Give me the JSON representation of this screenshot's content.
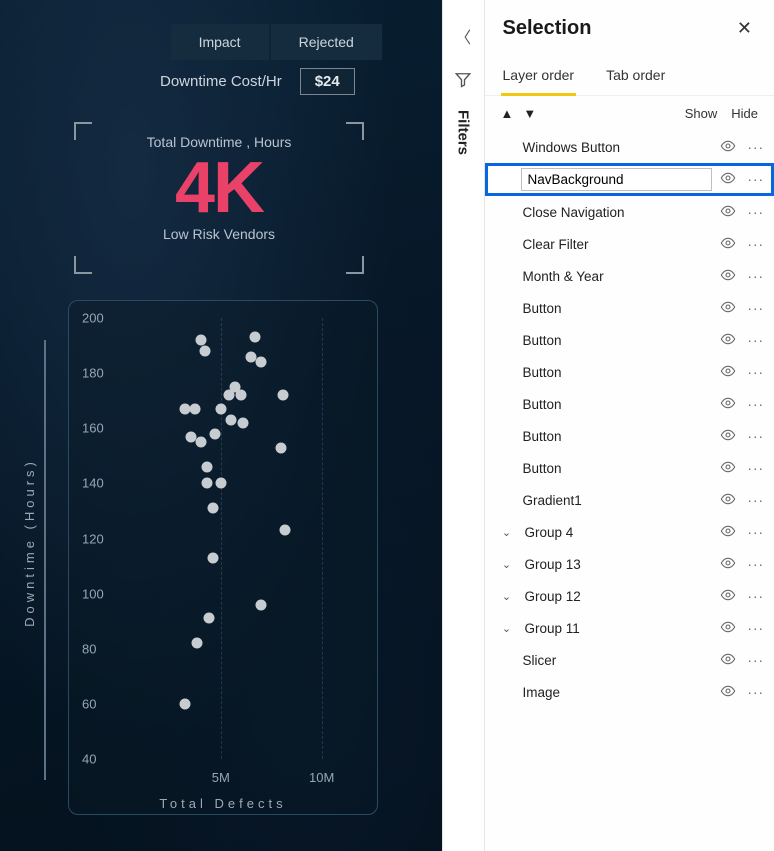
{
  "canvas": {
    "top_tabs": [
      "Impact",
      "Rejected"
    ],
    "kpi": {
      "label": "Downtime Cost/Hr",
      "value": "$24"
    },
    "metric": {
      "top": "Total Downtime , Hours",
      "value": "4K",
      "bottom": "Low Risk Vendors"
    },
    "ylabel": "Downtime (Hours)"
  },
  "chart_data": {
    "type": "scatter",
    "title": "",
    "xlabel": "Total Defects",
    "ylabel": "Downtime (Hours)",
    "xlim": [
      0,
      12000000
    ],
    "ylim": [
      40,
      200
    ],
    "x_ticks": [
      5000000,
      10000000
    ],
    "x_tick_labels": [
      "5M",
      "10M"
    ],
    "y_ticks": [
      40,
      60,
      80,
      100,
      120,
      140,
      160,
      180,
      200
    ],
    "series": [
      {
        "name": "Vendors",
        "points": [
          {
            "x": 4000000,
            "y": 192
          },
          {
            "x": 4200000,
            "y": 188
          },
          {
            "x": 6700000,
            "y": 193
          },
          {
            "x": 6500000,
            "y": 186
          },
          {
            "x": 7000000,
            "y": 184
          },
          {
            "x": 5700000,
            "y": 175
          },
          {
            "x": 5400000,
            "y": 172
          },
          {
            "x": 6000000,
            "y": 172
          },
          {
            "x": 8100000,
            "y": 172
          },
          {
            "x": 3200000,
            "y": 167
          },
          {
            "x": 3700000,
            "y": 167
          },
          {
            "x": 5000000,
            "y": 167
          },
          {
            "x": 5500000,
            "y": 163
          },
          {
            "x": 6100000,
            "y": 162
          },
          {
            "x": 3500000,
            "y": 157
          },
          {
            "x": 4000000,
            "y": 155
          },
          {
            "x": 4700000,
            "y": 158
          },
          {
            "x": 8000000,
            "y": 153
          },
          {
            "x": 4300000,
            "y": 146
          },
          {
            "x": 4300000,
            "y": 140
          },
          {
            "x": 5000000,
            "y": 140
          },
          {
            "x": 4600000,
            "y": 131
          },
          {
            "x": 8200000,
            "y": 123
          },
          {
            "x": 4600000,
            "y": 113
          },
          {
            "x": 7000000,
            "y": 96
          },
          {
            "x": 4400000,
            "y": 91
          },
          {
            "x": 3800000,
            "y": 82
          },
          {
            "x": 3200000,
            "y": 60
          }
        ]
      }
    ]
  },
  "filters": {
    "label": "Filters"
  },
  "selection": {
    "title": "Selection",
    "tabs": {
      "layer": "Layer order",
      "tab": "Tab order"
    },
    "controls": {
      "show": "Show",
      "hide": "Hide"
    },
    "items": [
      {
        "label": "Windows Button"
      },
      {
        "label": "NavBackground",
        "selected": true,
        "editing": true
      },
      {
        "label": "Close Navigation"
      },
      {
        "label": "Clear Filter"
      },
      {
        "label": "Month & Year"
      },
      {
        "label": "Button"
      },
      {
        "label": "Button"
      },
      {
        "label": "Button"
      },
      {
        "label": "Button"
      },
      {
        "label": "Button"
      },
      {
        "label": "Button"
      },
      {
        "label": "Gradient1"
      },
      {
        "label": "Group 4",
        "group": true
      },
      {
        "label": "Group 13",
        "group": true
      },
      {
        "label": "Group 12",
        "group": true
      },
      {
        "label": "Group 11",
        "group": true
      },
      {
        "label": "Slicer"
      },
      {
        "label": "Image"
      }
    ]
  }
}
